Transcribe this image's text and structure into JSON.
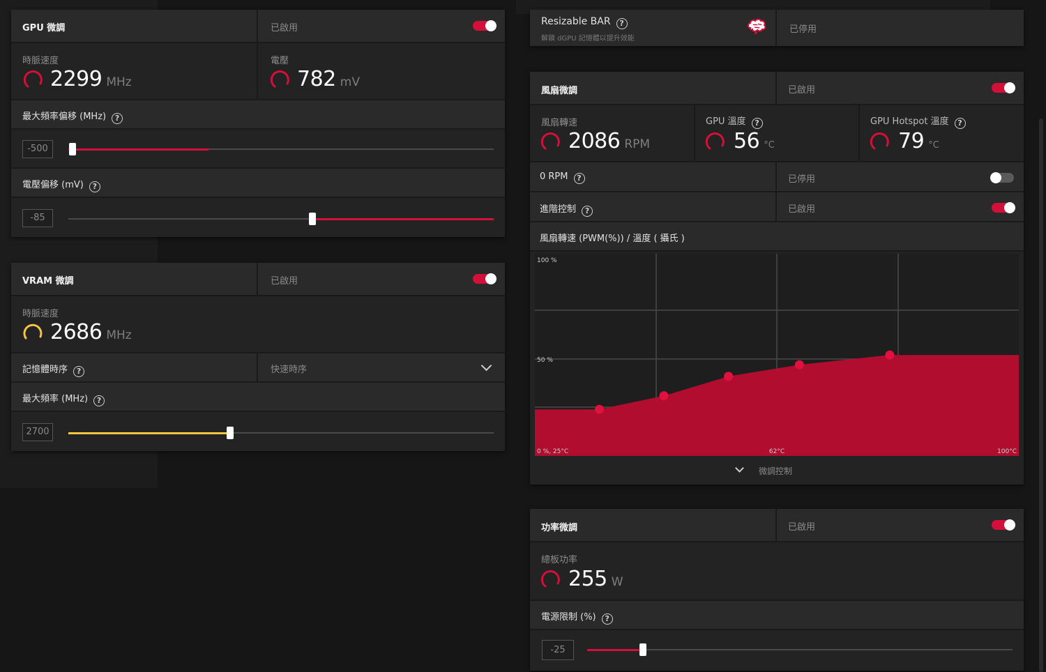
{
  "gpu_tuning": {
    "title": "GPU 微調",
    "status": "已啟用",
    "enabled": true,
    "clock_label": "時脈速度",
    "clock_value": "2299",
    "clock_unit": "MHz",
    "voltage_label": "電壓",
    "voltage_value": "782",
    "voltage_unit": "mV",
    "max_freq_offset_label": "最大頻率偏移 (MHz)",
    "max_freq_offset_value": "-500",
    "max_freq_offset_fraction": 0.33,
    "voltage_offset_label": "電壓偏移 (mV)",
    "voltage_offset_value": "-85",
    "voltage_offset_fraction": 0.57
  },
  "vram_tuning": {
    "title": "VRAM 微調",
    "status": "已啟用",
    "enabled": true,
    "clock_label": "時脈速度",
    "clock_value": "2686",
    "clock_unit": "MHz",
    "memory_timing_label": "記憶體時序",
    "memory_timing_value": "快速時序",
    "max_freq_label": "最大頻率 (MHz)",
    "max_freq_value": "2700",
    "max_freq_fraction": 0.38
  },
  "resizable_bar": {
    "title": "Resizable BAR",
    "subtitle": "解鎖 dGPU 記憶體以提升效能",
    "status": "已停用",
    "icon": "brain-icon"
  },
  "fan_tuning": {
    "title": "風扇微調",
    "status": "已啟用",
    "enabled": true,
    "fan_speed_label": "風扇轉速",
    "fan_speed_value": "2086",
    "fan_speed_unit": "RPM",
    "gpu_temp_label": "GPU 溫度",
    "gpu_temp_value": "56",
    "gpu_temp_unit": "°C",
    "hotspot_label": "GPU Hotspot 溫度",
    "hotspot_value": "79",
    "hotspot_unit": "°C",
    "zero_rpm_label": "0 RPM",
    "zero_rpm_status": "已停用",
    "zero_rpm_enabled": false,
    "advanced_label": "進階控制",
    "advanced_status": "已啟用",
    "advanced_enabled": true,
    "curve_title": "風扇轉速 (PWM(%)) / 溫度 ( 攝氏 )",
    "tuning_control_label": "微調控制"
  },
  "chart_data": {
    "type": "area",
    "title": "風扇轉速 (PWM(%)) / 溫度 ( 攝氏 )",
    "y_tick_labels": [
      "100 %",
      "50 %"
    ],
    "x_tick_labels": [
      "0 %, 25°C",
      "62°C",
      "100°C"
    ],
    "xlim": [
      25,
      100
    ],
    "ylim": [
      0,
      100
    ],
    "points": [
      {
        "x": 25,
        "y": 24
      },
      {
        "x": 35,
        "y": 24
      },
      {
        "x": 45,
        "y": 31
      },
      {
        "x": 55,
        "y": 41
      },
      {
        "x": 66,
        "y": 47
      },
      {
        "x": 80,
        "y": 52
      },
      {
        "x": 100,
        "y": 52
      }
    ],
    "handles": [
      {
        "x": 35,
        "y": 24
      },
      {
        "x": 45,
        "y": 31
      },
      {
        "x": 55,
        "y": 41
      },
      {
        "x": 66,
        "y": 47
      },
      {
        "x": 80,
        "y": 52
      }
    ],
    "grid": true,
    "fill_color": "#b10d2e",
    "handle_color": "#e0103f"
  },
  "power_tuning": {
    "title": "功率微調",
    "status": "已啟用",
    "enabled": true,
    "board_power_label": "總板功率",
    "board_power_value": "255",
    "board_power_unit": "W",
    "power_limit_label": "電源限制 (%)",
    "power_limit_value": "-25",
    "power_limit_fraction": 0.13
  },
  "colors": {
    "accent": "#d2103a",
    "vram_accent": "#f5c542",
    "panel": "#232323",
    "header": "#2a2a2a"
  }
}
